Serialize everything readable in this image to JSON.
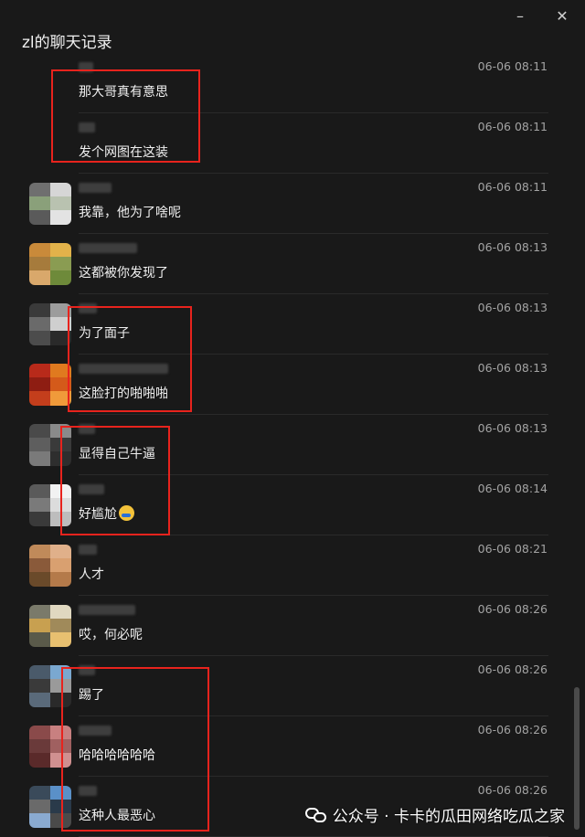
{
  "window": {
    "title": "zl的聊天记录",
    "minimize_glyph": "–",
    "close_glyph": "✕"
  },
  "messages": [
    {
      "text": "那大哥真有意思",
      "time": "06-06 08:11",
      "avatar": null,
      "name_width": 16
    },
    {
      "text": "发个网图在这装",
      "time": "06-06 08:11",
      "avatar": null,
      "name_width": 18
    },
    {
      "text": "我靠，他为了啥呢",
      "time": "06-06 08:11",
      "avatar": [
        "#6f6f6f",
        "#d6d6d6",
        "#8aa07a",
        "#b9c2b0",
        "#5a5a5a",
        "#e3e3e3"
      ],
      "name_width": 36
    },
    {
      "text": "这都被你发现了",
      "time": "06-06 08:13",
      "avatar": [
        "#c98a3a",
        "#e2b24a",
        "#a67b3c",
        "#8a9c52",
        "#d9a86b",
        "#6e8a3a"
      ],
      "name_width": 64
    },
    {
      "text": "为了面子",
      "time": "06-06 08:13",
      "avatar": [
        "#3a3a3a",
        "#9c9c9c",
        "#6a6a6a",
        "#cfcfcf",
        "#4c4c4c",
        "#2a2a2a"
      ],
      "name_width": 20
    },
    {
      "text": "这脸打的啪啪啪",
      "time": "06-06 08:13",
      "avatar": [
        "#b82a1a",
        "#e07a1f",
        "#8e1d12",
        "#d45a1a",
        "#c43e1c",
        "#f09a3a"
      ],
      "name_width": 98
    },
    {
      "text": "显得自己牛逼",
      "time": "06-06 08:13",
      "avatar": [
        "#4a4a4a",
        "#8a8a8a",
        "#5e5e5e",
        "#3a3a3a",
        "#7a7a7a",
        "#2e2e2e"
      ],
      "name_width": 18
    },
    {
      "text": "好尴尬",
      "time": "06-06 08:14",
      "avatar": [
        "#5a5a5a",
        "#f2f2f2",
        "#7a7a7a",
        "#dcdcdc",
        "#3a3a3a",
        "#bdbdbd"
      ],
      "name_width": 28,
      "emoji": "face-with-tears-emoji"
    },
    {
      "text": "人才",
      "time": "06-06 08:21",
      "avatar": [
        "#c08a5a",
        "#e0b08a",
        "#8a5a3a",
        "#d9a070",
        "#6a4a2a",
        "#b47a4a"
      ],
      "name_width": 20
    },
    {
      "text": "哎，何必呢",
      "time": "06-06 08:26",
      "avatar": [
        "#7a7a6a",
        "#e0d8c0",
        "#c8a050",
        "#a08a5a",
        "#5a5a4a",
        "#e8c070"
      ],
      "name_width": 62
    },
    {
      "text": "踢了",
      "time": "06-06 08:26",
      "avatar": [
        "#4a5a6a",
        "#7aa8d0",
        "#3a3a3a",
        "#9a9a9a",
        "#5a6a7a",
        "#2a2a2a"
      ],
      "name_width": 18
    },
    {
      "text": "哈哈哈哈哈哈",
      "time": "06-06 08:26",
      "avatar": [
        "#8a4a4a",
        "#c88080",
        "#6a3a3a",
        "#a06060",
        "#5a2a2a",
        "#d09090"
      ],
      "name_width": 36
    },
    {
      "text": "这种人最恶心",
      "time": "06-06 08:26",
      "avatar": [
        "#3a4a5a",
        "#5a90c8",
        "#6a6a6a",
        "#2a3a4a",
        "#8aaad0",
        "#4a4a4a"
      ],
      "name_width": 20
    }
  ],
  "watermark": {
    "text": "公众号 · 卡卡的瓜田网络吃瓜之家",
    "icon": "wechat-icon"
  },
  "colors": {
    "background": "#191919",
    "highlight_box": "#e8231d",
    "time_text": "#a3a3a3"
  }
}
